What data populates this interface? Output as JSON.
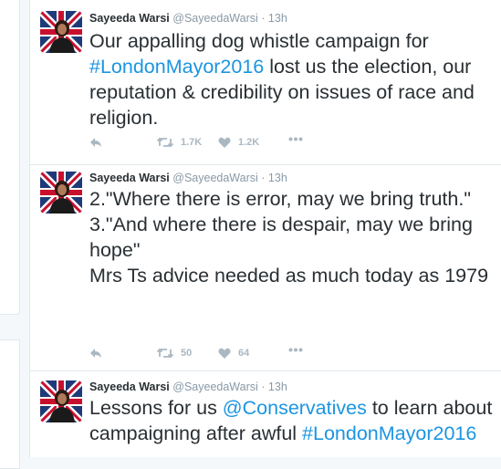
{
  "tweets": [
    {
      "fullname": "Sayeeda Warsi",
      "username": "@SayeedaWarsi",
      "sep": "·",
      "time": "13h",
      "text_parts": [
        "Our appalling dog whistle campaign for ",
        "#LondonMayor2016",
        " lost us the election, our reputation & credibility on issues of race and religion."
      ],
      "retweets": "1.7K",
      "likes": "1.2K"
    },
    {
      "fullname": "Sayeeda Warsi",
      "username": "@SayeedaWarsi",
      "sep": "·",
      "time": "13h",
      "text": "2.\"Where there is error, may we bring truth.\"\n3.\"And where there is despair, may we bring hope\"\nMrs Ts advice needed as much today as 1979",
      "retweets": "50",
      "likes": "64"
    },
    {
      "fullname": "Sayeeda Warsi",
      "username": "@SayeedaWarsi",
      "sep": "·",
      "time": "13h",
      "text_parts": [
        "Lessons for us ",
        "@Conservatives",
        " to learn about campaigning after awful ",
        "#LondonMayor2016"
      ]
    }
  ],
  "icons": {
    "reply": "reply-icon",
    "retweet": "retweet-icon",
    "like": "heart-icon",
    "more": "more-icon"
  },
  "colors": {
    "text": "#292f33",
    "link": "#1b95e0",
    "muted": "#8899a6",
    "action": "#aab8c2"
  }
}
